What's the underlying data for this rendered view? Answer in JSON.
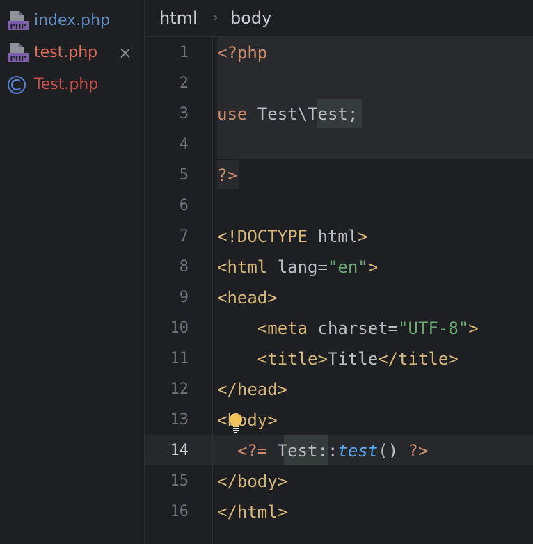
{
  "sidebar": {
    "files": [
      {
        "label": "index.php",
        "icon": "php-file-icon",
        "color": "#5a8fc4"
      },
      {
        "label": "test.php",
        "icon": "php-file-icon",
        "color": "#e06c5a",
        "close_glyph": "×"
      },
      {
        "label": "Test.php",
        "icon": "class-c-icon",
        "color": "#c8504a"
      }
    ]
  },
  "breadcrumb": {
    "items": [
      "html",
      "body"
    ],
    "separator": "›"
  },
  "editor": {
    "current_line": 14,
    "lines": [
      {
        "n": "1"
      },
      {
        "n": "2"
      },
      {
        "n": "3"
      },
      {
        "n": "4"
      },
      {
        "n": "5"
      },
      {
        "n": "6"
      },
      {
        "n": "7"
      },
      {
        "n": "8"
      },
      {
        "n": "9"
      },
      {
        "n": "10"
      },
      {
        "n": "11"
      },
      {
        "n": "12"
      },
      {
        "n": "13"
      },
      {
        "n": "14"
      },
      {
        "n": "15"
      },
      {
        "n": "16"
      }
    ],
    "code": {
      "l1": "<?php",
      "l3_use": "use",
      "l3_ns": "Test\\",
      "l3_cls": "Test",
      "l3_end": ";",
      "l5": "?>",
      "l7_tag": "<!DOCTYPE",
      "l7_attr": " html",
      "l7_end": ">",
      "l8_open": "<html",
      "l8_attr": " lang",
      "l8_eq": "=",
      "l8_str": "\"en\"",
      "l8_close": ">",
      "l9": "<head>",
      "l10_open": "    <meta",
      "l10_attr": " charset",
      "l10_eq": "=",
      "l10_str": "\"UTF-8\"",
      "l10_close": ">",
      "l11_open": "    <title>",
      "l11_text": "Title",
      "l11_close": "</title>",
      "l12": "</head>",
      "l13": "<body>",
      "l14_open": "  <?=",
      "l14_sp": " ",
      "l14_cls": "Test",
      "l14_op": "::",
      "l14_meth": "test",
      "l14_paren": "()",
      "l14_close": " ?>",
      "l15": "</body>",
      "l16": "</html>"
    }
  }
}
